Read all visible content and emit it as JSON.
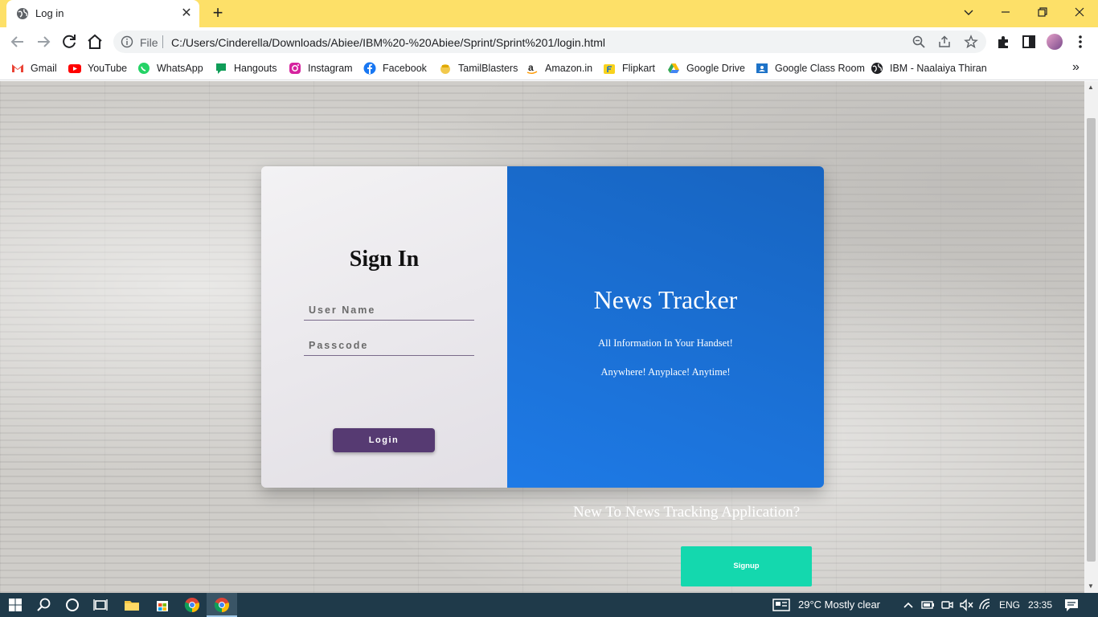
{
  "browser": {
    "tab_title": "Log in",
    "omnibox_scheme": "File",
    "url": "C:/Users/Cinderella/Downloads/Abiee/IBM%20-%20Abiee/Sprint/Sprint%201/login.html",
    "bookmarks": [
      {
        "label": "Gmail",
        "icon": "gmail-icon",
        "color": "#ea4335"
      },
      {
        "label": "YouTube",
        "icon": "youtube-icon",
        "color": "#ff0000"
      },
      {
        "label": "WhatsApp",
        "icon": "whatsapp-icon",
        "color": "#25d366"
      },
      {
        "label": "Hangouts",
        "icon": "hangouts-icon",
        "color": "#0f9d58"
      },
      {
        "label": "Instagram",
        "icon": "instagram-icon",
        "color": "#d6249f"
      },
      {
        "label": "Facebook",
        "icon": "facebook-icon",
        "color": "#1877f2"
      },
      {
        "label": "TamilBlasters",
        "icon": "tamilblasters-icon",
        "color": "#f2c94c"
      },
      {
        "label": "Amazon.in",
        "icon": "amazon-icon",
        "color": "#222222"
      },
      {
        "label": "Flipkart",
        "icon": "flipkart-icon",
        "color": "#f8d21c"
      },
      {
        "label": "Google Drive",
        "icon": "google-drive-icon",
        "color": "#34a853"
      },
      {
        "label": "Google Class Room",
        "icon": "google-classroom-icon",
        "color": "#1e73c8"
      },
      {
        "label": "IBM - Naalaiya Thiran",
        "icon": "ibm-globe-icon",
        "color": "#202124"
      }
    ]
  },
  "login": {
    "title": "Sign In",
    "username_placeholder": "User Name",
    "password_placeholder": "Passcode",
    "login_label": "Login"
  },
  "promo": {
    "title": "News Tracker",
    "tagline_1": "All Information In Your Handset!",
    "tagline_2": "Anywhere! Anyplace! Anytime!"
  },
  "signup": {
    "prompt": "New To News Tracking Application?",
    "button_label": "Signup"
  },
  "taskbar": {
    "weather": "29°C  Mostly clear",
    "language": "ENG",
    "time": "23:35"
  },
  "colors": {
    "tabstrip": "#fde068",
    "login_button": "#563a72",
    "promo_panel": "#1e7ae6",
    "signup_button": "#14d8ae",
    "taskbar": "#1f3a4a"
  }
}
